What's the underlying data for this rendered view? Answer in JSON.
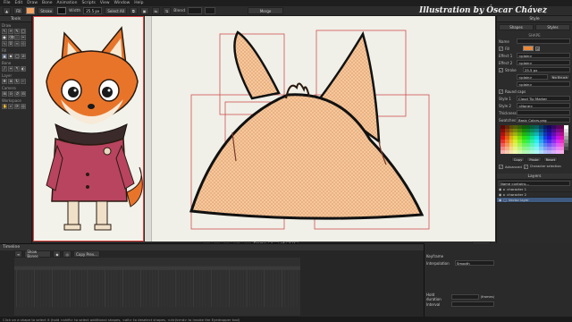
{
  "menu": [
    "File",
    "Edit",
    "Draw",
    "Bone",
    "Animation",
    "Scripts",
    "View",
    "Window",
    "Help"
  ],
  "credit": "Illustration by Óscar Chávez",
  "toolbar": {
    "fill_label": "Fill",
    "stroke_label": "Stroke",
    "width_label": "Width",
    "width_value": "25.5 px",
    "select_all": "Select All",
    "blend_label": "Blend",
    "merge_label": "Merge",
    "fill_color": "#f4a261",
    "stroke_color": "#111111"
  },
  "tools": {
    "header": "Tools",
    "groups": [
      "Draw",
      "Fill",
      "Bone",
      "Layer",
      "Camera",
      "Workspace"
    ]
  },
  "style_panel": {
    "header": "Style",
    "tabs": [
      "Shapes",
      "Styles"
    ],
    "section": "SHAPE",
    "name_label": "Name",
    "fill_label": "Fill",
    "effect1_label": "Effect 1",
    "effect1_value": "<plain>",
    "effect2_label": "Effect 2",
    "effect2_value": "<plain>",
    "stroke_label": "Stroke",
    "stroke_value": "25.5 px",
    "effect_s1": "<plain>",
    "effect_s2": "<plain>",
    "no_brush": "No Brush",
    "round_caps": "Round caps",
    "style1_label": "Style 1",
    "style1_value": "Cloud Tip Marker",
    "style2_label": "Style 2",
    "style2_value": "<None>",
    "thickness_label": "Thickness",
    "swatches_label": "Swatches",
    "swatches_value": "Basic Colors.png",
    "copy": "Copy",
    "paste": "Paste",
    "reset": "Reset",
    "advanced": "Advanced",
    "character_selection": "Character selection",
    "fill_color": "#e8893a"
  },
  "layers_panel": {
    "header": "Layers",
    "name_contains": "Name contains...",
    "rows": [
      "character 1",
      "character 2",
      "Vector layer"
    ]
  },
  "canvas": {
    "frame_label": "Frame",
    "frame_value": "0",
    "of_label": "of",
    "of_value": "240",
    "display": "Display"
  },
  "timeline": {
    "header": "Timeline",
    "show_bones": "Show Bones",
    "copy_prev": "Copy Prev...",
    "keyframe_label": "Keyframe",
    "interpolation_label": "Interpolation",
    "interpolation_value": "Smooth",
    "hold_duration": "Hold duration",
    "hold_unit": "(frames)",
    "interval_label": "Interval"
  },
  "status": "Click on a shape to select it (hold <shift> to select additional shapes, <alt> to deselect shapes, <ctrl/cmd> to invoke the Eyedropper tool)"
}
